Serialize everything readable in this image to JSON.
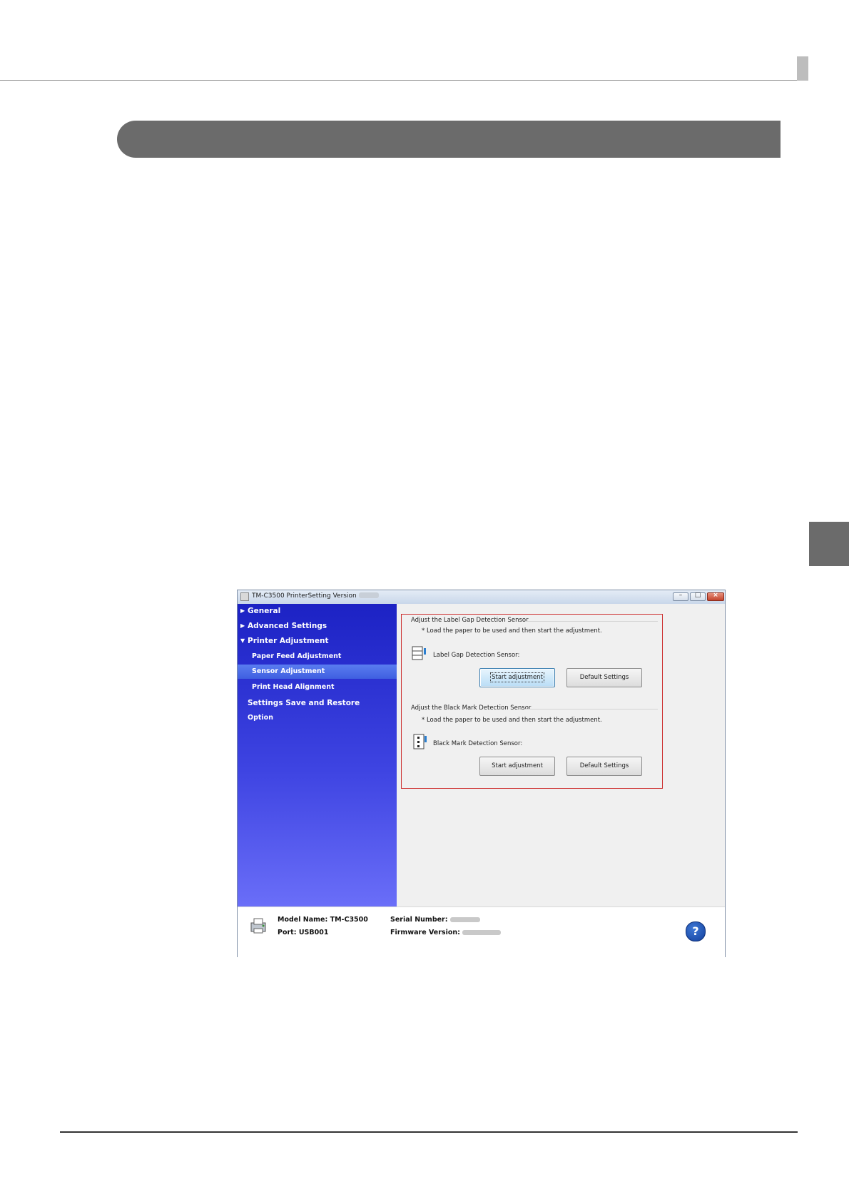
{
  "window": {
    "title": "TM-C3500 PrinterSetting Version",
    "minimize_glyph": "–",
    "maximize_glyph": "□",
    "close_glyph": "×"
  },
  "sidebar": {
    "items": [
      {
        "label": "General",
        "arrow": "▶"
      },
      {
        "label": "Advanced Settings",
        "arrow": "▶"
      },
      {
        "label": "Printer Adjustment",
        "arrow": "▼"
      },
      {
        "label": "Paper Feed Adjustment"
      },
      {
        "label": "Sensor Adjustment",
        "selected": true
      },
      {
        "label": "Print Head Alignment"
      },
      {
        "label": "Settings Save and Restore"
      },
      {
        "label": "Option"
      }
    ]
  },
  "label_gap": {
    "group_title": "Adjust the Label Gap Detection Sensor",
    "note": "* Load the paper to be used and then start the adjustment.",
    "sensor_label": "Label Gap Detection Sensor:",
    "start_button": "Start adjustment",
    "default_button": "Default Settings"
  },
  "black_mark": {
    "group_title": "Adjust the Black Mark Detection Sensor",
    "note": "* Load the paper to be used and then start the adjustment.",
    "sensor_label": "Black Mark Detection Sensor:",
    "start_button": "Start adjustment",
    "default_button": "Default Settings"
  },
  "footer": {
    "model_name": "Model Name: TM-C3500",
    "port": "Port: USB001",
    "serial_number_label": "Serial Number:",
    "firmware_version_label": "Firmware Version:",
    "help_glyph": "?"
  },
  "colors": {
    "sidebar_top": "#1c22c4",
    "sidebar_bottom": "#6a6ef8",
    "highlight_box": "#cc2a2a",
    "title_band": "#6b6b6b"
  }
}
